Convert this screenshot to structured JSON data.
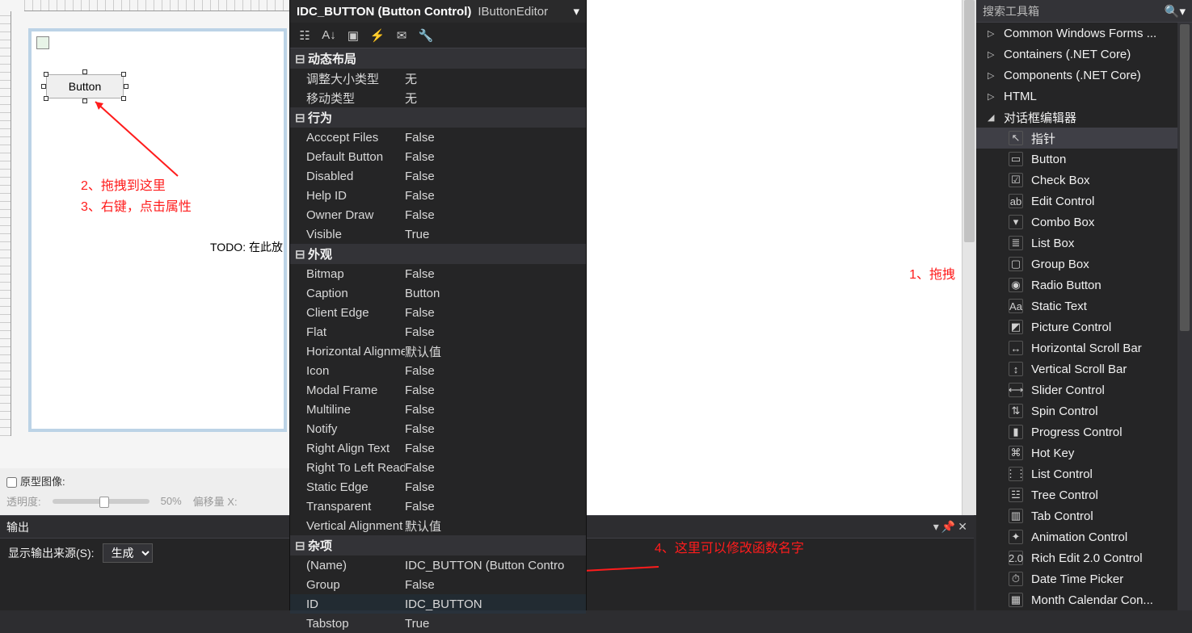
{
  "designer": {
    "button_label": "Button",
    "todo_text": "TODO: 在此放",
    "annot_line1": "2、拖拽到这里",
    "annot_line2": "3、右键，点击属性",
    "annot_right": "1、拖拽",
    "annot_mid": "4、这里可以修改函数名字",
    "proto_label": "原型图像:",
    "opacity_label": "透明度:",
    "opacity_val": "50%",
    "offset_label": "偏移量 X:"
  },
  "output": {
    "panel_title": "输出",
    "src_label": "显示输出来源(S):",
    "src_value": "生成"
  },
  "props": {
    "title_main": "IDC_BUTTON (Button Control)",
    "title_sel": "IButtonEditor",
    "cat1": "动态布局",
    "rows1": [
      {
        "k": "调整大小类型",
        "v": "无"
      },
      {
        "k": "移动类型",
        "v": "无"
      }
    ],
    "cat2": "行为",
    "rows2": [
      {
        "k": "Acccept Files",
        "v": "False"
      },
      {
        "k": "Default Button",
        "v": "False"
      },
      {
        "k": "Disabled",
        "v": "False"
      },
      {
        "k": "Help ID",
        "v": "False"
      },
      {
        "k": "Owner Draw",
        "v": "False"
      },
      {
        "k": "Visible",
        "v": "True"
      }
    ],
    "cat3": "外观",
    "rows3": [
      {
        "k": "Bitmap",
        "v": "False"
      },
      {
        "k": "Caption",
        "v": "Button"
      },
      {
        "k": "Client Edge",
        "v": "False"
      },
      {
        "k": "Flat",
        "v": "False"
      },
      {
        "k": "Horizontal Alignme",
        "v": "默认值"
      },
      {
        "k": "Icon",
        "v": "False"
      },
      {
        "k": "Modal Frame",
        "v": "False"
      },
      {
        "k": "Multiline",
        "v": "False"
      },
      {
        "k": "Notify",
        "v": "False"
      },
      {
        "k": "Right Align Text",
        "v": "False"
      },
      {
        "k": "Right To Left Readi",
        "v": "False"
      },
      {
        "k": "Static Edge",
        "v": "False"
      },
      {
        "k": "Transparent",
        "v": "False"
      },
      {
        "k": "Vertical Alignment",
        "v": "默认值"
      }
    ],
    "cat4": "杂项",
    "rows4": [
      {
        "k": "(Name)",
        "v": "IDC_BUTTON (Button Contro"
      },
      {
        "k": "Group",
        "v": "False"
      },
      {
        "k": "ID",
        "v": "IDC_BUTTON"
      },
      {
        "k": "Tabstop",
        "v": "True"
      }
    ]
  },
  "toolbox": {
    "search_placeholder": "搜索工具箱",
    "groups": [
      {
        "label": "Common Windows Forms ..."
      },
      {
        "label": "Containers (.NET Core)"
      },
      {
        "label": "Components (.NET Core)"
      },
      {
        "label": "HTML"
      }
    ],
    "editor_group": "对话框编辑器",
    "items": [
      {
        "ic": "↖",
        "label": "指针",
        "sel": true
      },
      {
        "ic": "▭",
        "label": "Button"
      },
      {
        "ic": "☑",
        "label": "Check Box"
      },
      {
        "ic": "ab",
        "label": "Edit Control"
      },
      {
        "ic": "▾",
        "label": "Combo Box"
      },
      {
        "ic": "≣",
        "label": "List Box"
      },
      {
        "ic": "▢",
        "label": "Group Box"
      },
      {
        "ic": "◉",
        "label": "Radio Button"
      },
      {
        "ic": "Aa",
        "label": "Static Text"
      },
      {
        "ic": "◩",
        "label": "Picture Control"
      },
      {
        "ic": "↔",
        "label": "Horizontal Scroll Bar"
      },
      {
        "ic": "↕",
        "label": "Vertical Scroll Bar"
      },
      {
        "ic": "⟷",
        "label": "Slider Control"
      },
      {
        "ic": "⇅",
        "label": "Spin Control"
      },
      {
        "ic": "▮",
        "label": "Progress Control"
      },
      {
        "ic": "⌘",
        "label": "Hot Key"
      },
      {
        "ic": "⋮⋮",
        "label": "List Control"
      },
      {
        "ic": "☳",
        "label": "Tree Control"
      },
      {
        "ic": "▥",
        "label": "Tab Control"
      },
      {
        "ic": "✦",
        "label": "Animation Control"
      },
      {
        "ic": "2.0",
        "label": "Rich Edit 2.0 Control"
      },
      {
        "ic": "⏱",
        "label": "Date Time Picker"
      },
      {
        "ic": "▦",
        "label": "Month Calendar Con..."
      }
    ]
  }
}
